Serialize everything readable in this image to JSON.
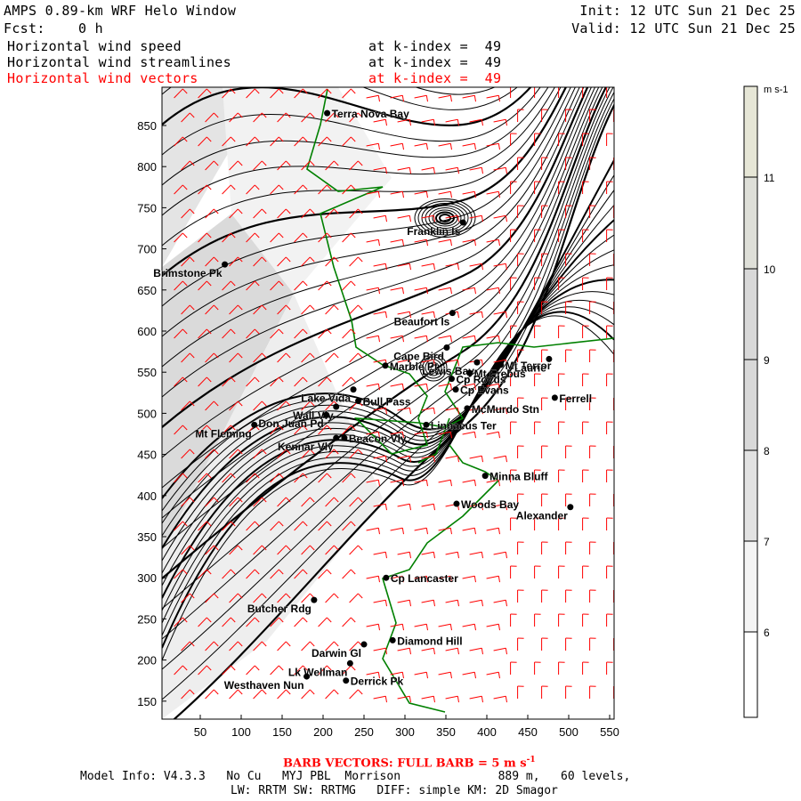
{
  "header": {
    "title": "AMPS 0.89-km WRF Helo Window",
    "fcst": "Fcst:    0 h",
    "init": "Init: 12 UTC Sun 21 Dec 25",
    "valid": "Valid: 12 UTC Sun 21 Dec 25",
    "fields": [
      {
        "name": "Horizontal wind speed",
        "k": "at k-index =  49"
      },
      {
        "name": "Horizontal wind streamlines",
        "k": "at k-index =  49"
      },
      {
        "name": "Horizontal wind vectors",
        "k": "at k-index =  49"
      }
    ]
  },
  "colors": {
    "vectors": "#ff0000",
    "coast": "#008000"
  },
  "chart_data": {
    "type": "contour-map",
    "title": "Horizontal wind speed / streamlines / vectors",
    "xlim": [
      0,
      555
    ],
    "ylim": [
      125,
      885
    ],
    "xticks": [
      "50",
      "100",
      "150",
      "200",
      "250",
      "300",
      "350",
      "400",
      "450",
      "500",
      "550"
    ],
    "yticks": [
      "150",
      "200",
      "250",
      "300",
      "350",
      "400",
      "450",
      "500",
      "550",
      "600",
      "650",
      "700",
      "750",
      "800",
      "850"
    ],
    "colorbar": {
      "unit": "m s-1",
      "levels": [
        "6",
        "7",
        "8",
        "9",
        "10",
        "11"
      ],
      "fills": [
        "#ffffff",
        "#f4f4f4",
        "#e2e2e2",
        "#d8d8d8",
        "#d8d8d8",
        "#dedfd8",
        "#e6e6d6"
      ]
    },
    "places": [
      {
        "name": "Terra Nova Bay",
        "x": 205,
        "y": 865
      },
      {
        "name": "Franklin Is",
        "x": 371,
        "y": 732
      },
      {
        "name": "Brimstone Pk",
        "x": 80,
        "y": 681
      },
      {
        "name": "Beaufort Is",
        "x": 358,
        "y": 622
      },
      {
        "name": "Cape Bird",
        "x": 351,
        "y": 580
      },
      {
        "name": "Lewis Bay",
        "x": 388,
        "y": 562
      },
      {
        "name": "Mt Terror",
        "x": 417,
        "y": 559
      },
      {
        "name": "Mt Erebus",
        "x": 379,
        "y": 549
      },
      {
        "name": "Laurie",
        "x": 476,
        "y": 566
      },
      {
        "name": "Marble Pt",
        "x": 276,
        "y": 558
      },
      {
        "name": "Cp Royds",
        "x": 357,
        "y": 542
      },
      {
        "name": "Cp Evans",
        "x": 362,
        "y": 529
      },
      {
        "name": "McMurdo Stn",
        "x": 376,
        "y": 506
      },
      {
        "name": "Ferrell",
        "x": 483,
        "y": 519
      },
      {
        "name": "Lake Vida",
        "x": 237,
        "y": 529
      },
      {
        "name": "Wall Vly",
        "x": 216,
        "y": 508
      },
      {
        "name": "Don Juan Pd",
        "x": 204,
        "y": 498
      },
      {
        "name": "Bull Pass",
        "x": 243,
        "y": 515
      },
      {
        "name": "Linnaeus Ter",
        "x": 326,
        "y": 486
      },
      {
        "name": "Mt Fleming",
        "x": 116,
        "y": 486
      },
      {
        "name": "Kennar Vly",
        "x": 216,
        "y": 470
      },
      {
        "name": "Beacon Vly",
        "x": 226,
        "y": 470
      },
      {
        "name": "Minna Bluff",
        "x": 398,
        "y": 424
      },
      {
        "name": "Woods Bay",
        "x": 363,
        "y": 390
      },
      {
        "name": "Alexander",
        "x": 502,
        "y": 386
      },
      {
        "name": "Cp Lancaster",
        "x": 277,
        "y": 300
      },
      {
        "name": "Butcher Rdg",
        "x": 189,
        "y": 273
      },
      {
        "name": "Darwin Gl",
        "x": 250,
        "y": 219
      },
      {
        "name": "Diamond Hill",
        "x": 285,
        "y": 224
      },
      {
        "name": "Lk Wellman",
        "x": 233,
        "y": 196
      },
      {
        "name": "Westhaven Nun",
        "x": 180,
        "y": 180
      },
      {
        "name": "Derrick Pk",
        "x": 228,
        "y": 175
      }
    ]
  },
  "footer": {
    "barb": "BARB VECTORS:  FULL BARB = 5 m s",
    "barb_sup": "-1",
    "model": "Model Info: V4.3.3   No Cu   MYJ PBL  Morrison              889 m,   60 levels,",
    "model2": "LW: RRTM SW: RRTMG   DIFF: simple KM: 2D Smagor"
  }
}
